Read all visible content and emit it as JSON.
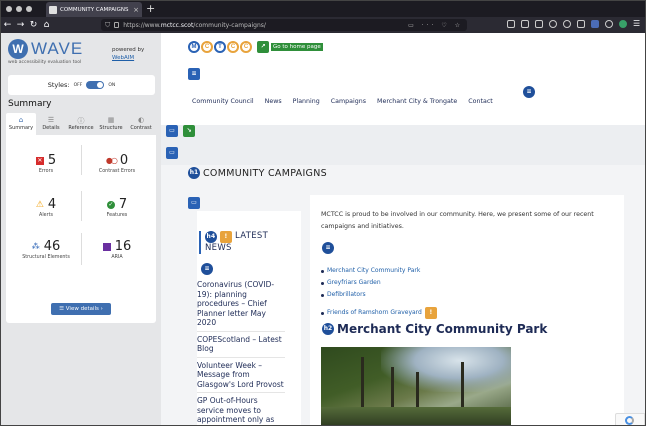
{
  "browser": {
    "tab_title": "COMMUNITY CAMPAIGNS – M",
    "tab_close": "×",
    "new_tab": "+",
    "url_prefix": "https://www.",
    "url_domain": "mctcc.scot",
    "url_path": "/community-campaigns/",
    "url_tools": "▭ ··· ♡ ☆",
    "back": "←",
    "forward": "→",
    "reload": "↻",
    "home": "⌂"
  },
  "wave": {
    "logo_letter": "W",
    "logo_text": "WAVE",
    "subtitle": "web accessibility evaluation tool",
    "powered_by": "powered by",
    "webaim": "WebAIM",
    "styles_label": "Styles:",
    "styles_off": "OFF",
    "styles_on": "ON",
    "summary_heading": "Summary",
    "tabs": [
      {
        "label": "Summary",
        "icon": "⌂"
      },
      {
        "label": "Details",
        "icon": "☰"
      },
      {
        "label": "Reference",
        "icon": "ⓘ"
      },
      {
        "label": "Structure",
        "icon": "▦"
      },
      {
        "label": "Contrast",
        "icon": "◐"
      }
    ],
    "stats": {
      "errors": {
        "count": "5",
        "label": "Errors"
      },
      "contrast": {
        "count": "0",
        "label": "Contrast Errors"
      },
      "alerts": {
        "count": "4",
        "label": "Alerts"
      },
      "features": {
        "count": "7",
        "label": "Features"
      },
      "structural": {
        "count": "46",
        "label": "Structural Elements"
      },
      "aria": {
        "count": "16",
        "label": "ARIA"
      }
    },
    "view_details": "☰  View details ›"
  },
  "site": {
    "logo_letters": [
      "M",
      "C",
      "T",
      "C",
      "C"
    ],
    "home_link": "Go to home page",
    "nav": [
      "Community Council",
      "News",
      "Planning",
      "Campaigns",
      "Merchant City & Trongate",
      "Contact"
    ],
    "page_title": "COMMUNITY CAMPAIGNS",
    "news_heading": "LATEST NEWS",
    "news_items": [
      "Coronavirus (COVID-19): planning procedures – Chief Planner letter May 2020",
      "COPEScotland – Latest Blog",
      "Volunteer Week – Message from Glasgow's Lord Provost",
      "GP Out-of-Hours service moves to appointment only as part of urgent primary"
    ],
    "intro": "MCTCC is proud to be involved in our community. Here, we present some of our recent campaigns and initiatives.",
    "campaign_links": [
      "Merchant City Community Park",
      "Greyfriars Garden",
      "Defibrillators",
      "Friends of Ramshorn Graveyard"
    ],
    "section_heading": "Merchant City Community Park"
  },
  "wave_badges": {
    "h1": "h1",
    "h2": "h2",
    "h4": "h4"
  },
  "colors": {
    "wave_blue": "#3f6fb0",
    "error_red": "#d62c2c",
    "alert_orange": "#f1a10e",
    "feature_green": "#2f8f3a",
    "structure_blue": "#2a62b5",
    "aria_purple": "#6a2fa0",
    "site_navy": "#1e2b56"
  }
}
